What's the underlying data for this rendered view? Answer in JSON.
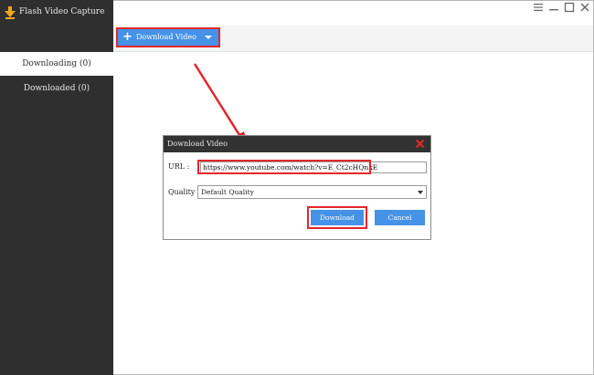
{
  "app": {
    "title": "Flash Video Capture"
  },
  "sidebar": {
    "items": [
      {
        "label": "Downloading (0)",
        "active": true
      },
      {
        "label": "Downloaded (0)",
        "active": false
      }
    ]
  },
  "window_controls": [
    "menu-icon",
    "minimize-icon",
    "maximize-icon",
    "close-icon"
  ],
  "toolbar": {
    "download_video_label": "Download Video"
  },
  "dialog": {
    "title": "Download Video",
    "url_label": "URL :",
    "url_value": "https://www.youtube.com/watch?v=E_Ct2cHQnkE",
    "quality_label": "Quality",
    "quality_value": "Default Quality",
    "download_label": "Download",
    "cancel_label": "Cancel"
  },
  "colors": {
    "sidebar_bg": "#2f2f2f",
    "accent_blue": "#4592e7",
    "highlight_red": "#e5262b",
    "dialog_header": "#323232"
  }
}
